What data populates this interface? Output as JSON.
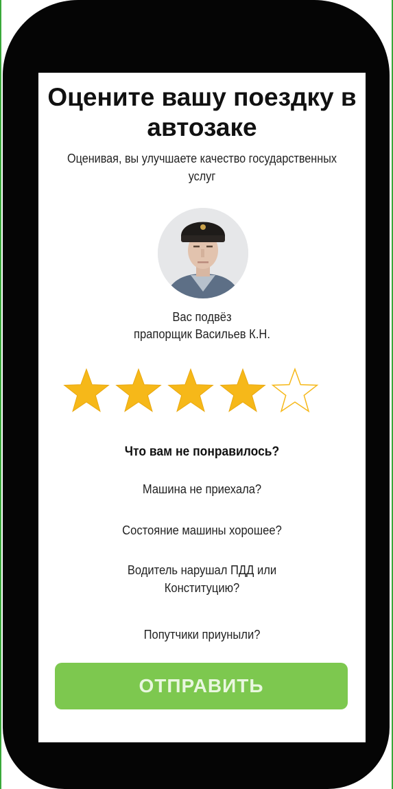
{
  "screen": {
    "title": "Оцените вашу поездку в автозаке",
    "subtitle": "Оценивая, вы улучшаете качество государственных услуг"
  },
  "driver": {
    "line1": "Вас подвёз",
    "line2": "прапорщик Васильев К.Н."
  },
  "rating": {
    "value": 4,
    "max": 5,
    "filled_color": "#f6b819",
    "empty_color": "#f6b819"
  },
  "feedback": {
    "question": "Что вам не понравилось?",
    "options": [
      "Машина не приехала?",
      "Состояние машины хорошее?",
      [
        "Водитель нарушал ПДД или",
        "Конституцию?"
      ],
      "Попутчики приуныли?"
    ]
  },
  "submit": {
    "label": "ОТПРАВИТЬ",
    "color": "#7dc84f"
  },
  "icons": {
    "avatar": "officer-portrait-icon",
    "star": "star-icon"
  }
}
